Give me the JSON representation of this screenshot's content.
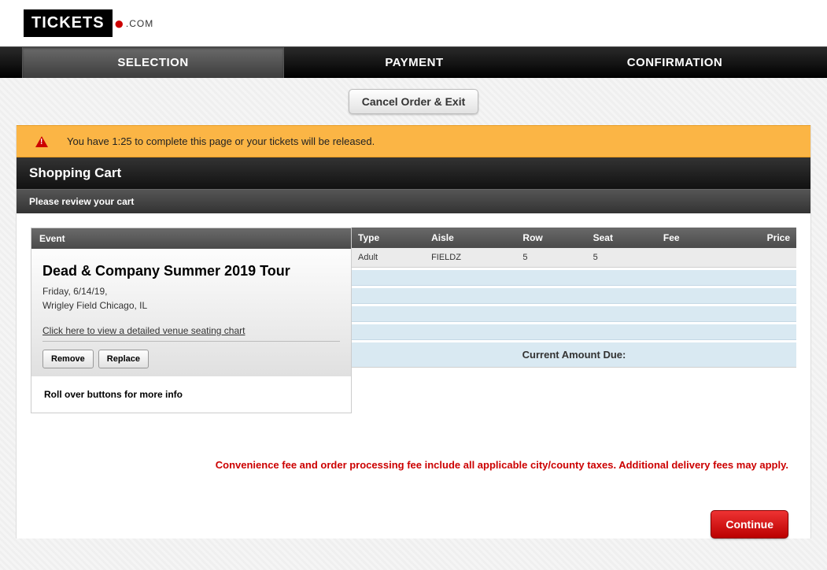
{
  "logo": {
    "text": "TICKETS",
    "suffix": ".COM"
  },
  "nav": {
    "selection": "SELECTION",
    "payment": "PAYMENT",
    "confirmation": "CONFIRMATION"
  },
  "cancel_button": "Cancel Order & Exit",
  "alert": {
    "message": "You have 1:25 to complete this page or your tickets will be released."
  },
  "section": {
    "title": "Shopping Cart",
    "subtitle": "Please review your cart"
  },
  "event": {
    "header": "Event",
    "title": "Dead & Company Summer 2019 Tour",
    "date": "Friday, 6/14/19,",
    "venue": "Wrigley Field Chicago, IL",
    "seating_link": "Click here to view a detailed venue seating chart",
    "remove_button": "Remove",
    "replace_button": "Replace",
    "hint": "Roll over buttons for more info"
  },
  "tickets": {
    "columns": {
      "type": "Type",
      "aisle": "Aisle",
      "row": "Row",
      "seat": "Seat",
      "fee": "Fee",
      "price": "Price"
    },
    "rows": [
      {
        "type": "Adult",
        "aisle": "FIELDZ",
        "row": "5",
        "seat": "5",
        "fee": "",
        "price": ""
      }
    ],
    "current_due_label": "Current Amount Due:"
  },
  "fee_note": "Convenience fee and order processing fee include all applicable city/county taxes. Additional delivery fees may apply.",
  "continue_button": "Continue"
}
